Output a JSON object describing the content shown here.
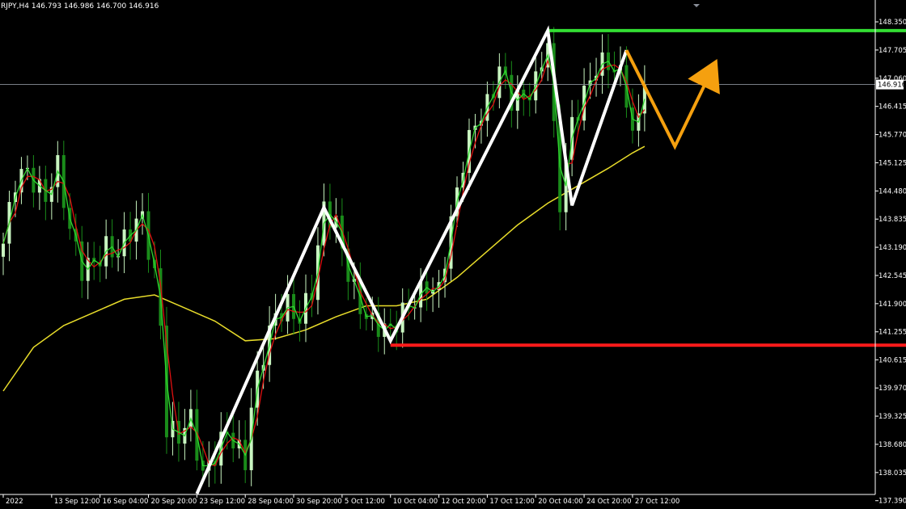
{
  "header": {
    "symbol_line": "RJPY,H4  146.793 146.986 146.700 146.916"
  },
  "colors": {
    "background": "#000000",
    "bull_candle": "#c8f5c0",
    "bear_candle": "#1a8c1a",
    "ma_fast": "#2fd62f",
    "ma_signal": "#e01010",
    "ma_slow": "#e8dc2a",
    "zigzag": "#ffffff",
    "projection": "#f5a00f",
    "resistance": "#33dd33",
    "support": "#ff1a1a",
    "current_price_line": "#8a8f99"
  },
  "chart_data": {
    "type": "candlestick",
    "symbol": "RJPY",
    "timeframe": "H4",
    "ohlc_last": {
      "open": 146.793,
      "high": 146.986,
      "low": 146.7,
      "close": 146.916
    },
    "current_price": 146.916,
    "ylim": [
      137.2,
      148.85
    ],
    "y_ticks": [
      "148.350",
      "147.705",
      "147.060",
      "146.415",
      "145.770",
      "145.125",
      "144.480",
      "143.835",
      "143.190",
      "142.545",
      "141.900",
      "141.255",
      "140.615",
      "139.970",
      "139.325",
      "138.680",
      "138.035",
      "137.390"
    ],
    "y_tick_values": [
      148.35,
      147.705,
      147.06,
      146.415,
      145.77,
      145.125,
      144.48,
      143.835,
      143.19,
      142.545,
      141.9,
      141.255,
      140.615,
      139.97,
      139.325,
      138.68,
      138.035,
      137.39
    ],
    "x_ticks": [
      "2022",
      "13 Sep 12:00",
      "16 Sep 04:00",
      "20 Sep 20:00",
      "23 Sep 12:00",
      "28 Sep 04:00",
      "30 Sep 20:00",
      "5 Oct 12:00",
      "10 Oct 04:00",
      "12 Oct 20:00",
      "17 Oct 12:00",
      "20 Oct 04:00",
      "24 Oct 20:00",
      "27 Oct 12:00"
    ],
    "x_tick_index": [
      0,
      8,
      16,
      24,
      32,
      40,
      48,
      56,
      64,
      72,
      80,
      88,
      96,
      104
    ],
    "num_bars": 107,
    "anchors": [
      [
        0,
        143.1
      ],
      [
        2,
        144.7
      ],
      [
        4,
        145.1
      ],
      [
        7,
        144.4
      ],
      [
        9,
        144.9
      ],
      [
        11,
        143.4
      ],
      [
        13,
        142.7
      ],
      [
        15,
        143.0
      ],
      [
        17,
        143.3
      ],
      [
        19,
        143.0
      ],
      [
        21,
        143.4
      ],
      [
        23,
        143.8
      ],
      [
        25,
        142.6
      ],
      [
        26,
        141.6
      ],
      [
        27,
        139.2
      ],
      [
        29,
        138.9
      ],
      [
        31,
        139.1
      ],
      [
        32,
        138.4
      ],
      [
        33,
        137.8
      ],
      [
        35,
        138.5
      ],
      [
        37,
        139.2
      ],
      [
        39,
        138.6
      ],
      [
        40,
        138.3
      ],
      [
        41,
        139.4
      ],
      [
        43,
        140.6
      ],
      [
        45,
        141.6
      ],
      [
        47,
        142.0
      ],
      [
        49,
        141.7
      ],
      [
        51,
        142.2
      ],
      [
        53,
        143.9
      ],
      [
        55,
        143.6
      ],
      [
        57,
        142.7
      ],
      [
        59,
        142.0
      ],
      [
        61,
        141.5
      ],
      [
        63,
        141.2
      ],
      [
        64,
        141.1
      ],
      [
        66,
        141.6
      ],
      [
        68,
        142.1
      ],
      [
        70,
        142.5
      ],
      [
        72,
        142.2
      ],
      [
        74,
        143.6
      ],
      [
        76,
        145.0
      ],
      [
        78,
        146.1
      ],
      [
        80,
        146.6
      ],
      [
        82,
        147.4
      ],
      [
        84,
        146.5
      ],
      [
        86,
        146.4
      ],
      [
        88,
        146.9
      ],
      [
        90,
        148.1
      ],
      [
        91,
        146.0
      ],
      [
        92,
        144.4
      ],
      [
        94,
        146.0
      ],
      [
        96,
        146.5
      ],
      [
        98,
        147.2
      ],
      [
        100,
        147.5
      ],
      [
        102,
        147.3
      ],
      [
        103,
        146.8
      ],
      [
        104,
        145.8
      ],
      [
        105,
        146.1
      ],
      [
        106,
        146.9
      ]
    ],
    "ma_slow": [
      [
        0,
        139.9
      ],
      [
        5,
        140.9
      ],
      [
        10,
        141.4
      ],
      [
        15,
        141.7
      ],
      [
        20,
        142.0
      ],
      [
        25,
        142.1
      ],
      [
        30,
        141.8
      ],
      [
        35,
        141.5
      ],
      [
        40,
        141.05
      ],
      [
        45,
        141.1
      ],
      [
        50,
        141.3
      ],
      [
        55,
        141.6
      ],
      [
        60,
        141.85
      ],
      [
        65,
        141.85
      ],
      [
        70,
        142.0
      ],
      [
        75,
        142.5
      ],
      [
        80,
        143.1
      ],
      [
        85,
        143.7
      ],
      [
        90,
        144.2
      ],
      [
        95,
        144.6
      ],
      [
        100,
        145.0
      ],
      [
        104,
        145.35
      ],
      [
        106,
        145.5
      ]
    ],
    "zigzag": [
      [
        32,
        137.55
      ],
      [
        53,
        144.1
      ],
      [
        64,
        141.05
      ],
      [
        90,
        148.15
      ],
      [
        94,
        144.15
      ],
      [
        103,
        147.7
      ]
    ],
    "projection": [
      [
        103,
        147.7
      ],
      [
        111,
        145.5
      ],
      [
        118,
        147.5
      ]
    ],
    "resistance": {
      "value": 148.15,
      "from_index": 90
    },
    "support": {
      "value": 140.95,
      "from_index": 64
    }
  }
}
